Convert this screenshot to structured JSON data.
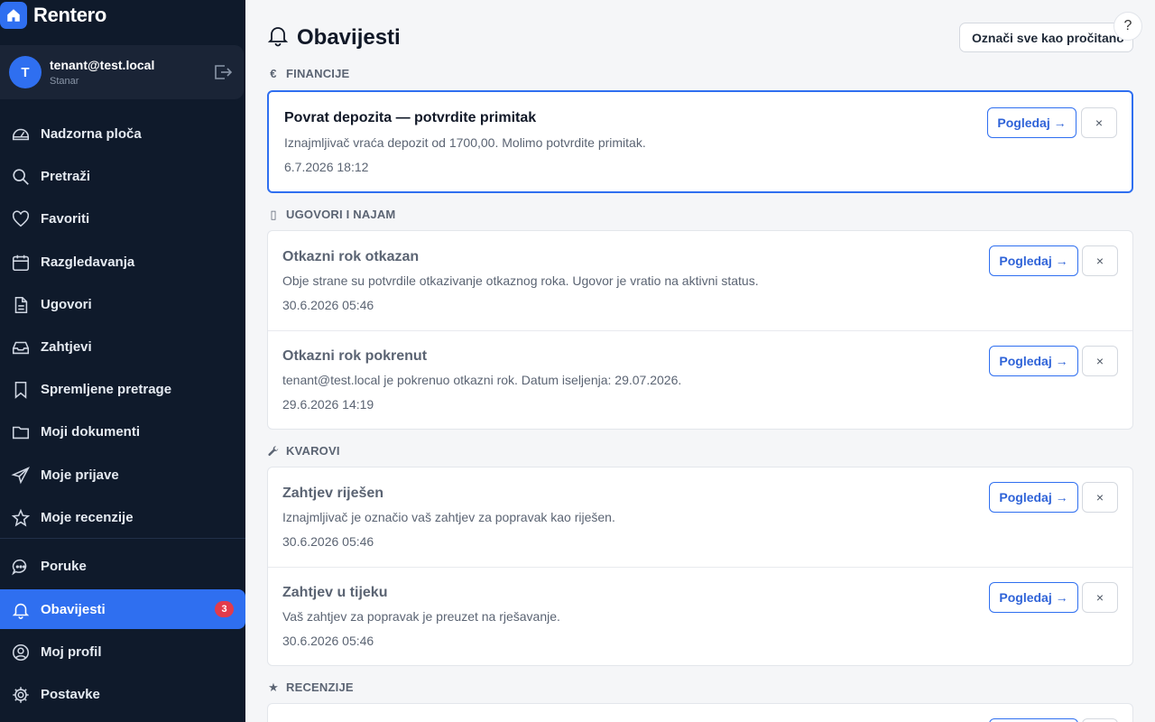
{
  "brand": {
    "name": "Rentero",
    "icon": "home-icon"
  },
  "user": {
    "initial": "T",
    "email": "tenant@test.local",
    "role": "Stanar"
  },
  "nav": [
    {
      "label": "Nadzorna ploča",
      "icon": "dashboard-icon"
    },
    {
      "label": "Pretraži",
      "icon": "search-icon"
    },
    {
      "label": "Favoriti",
      "icon": "heart-icon"
    },
    {
      "label": "Razgledavanja",
      "icon": "calendar-icon"
    },
    {
      "label": "Ugovori",
      "icon": "document-icon"
    },
    {
      "label": "Zahtjevi",
      "icon": "inbox-icon"
    },
    {
      "label": "Spremljene pretrage",
      "icon": "bookmark-icon"
    },
    {
      "label": "Moji dokumenti",
      "icon": "folder-icon"
    },
    {
      "label": "Moje prijave",
      "icon": "send-icon"
    },
    {
      "label": "Moje recenzije",
      "icon": "star-icon"
    },
    {
      "label": "Poruke",
      "icon": "chat-icon"
    },
    {
      "label": "Obavijesti",
      "icon": "bell-icon",
      "badge": "3",
      "active": true
    },
    {
      "label": "Moj profil",
      "icon": "user-circle-icon"
    },
    {
      "label": "Postavke",
      "icon": "gear-icon"
    }
  ],
  "header": {
    "title": "Obavijesti",
    "mark_all": "Označi sve kao pročitano",
    "help": "?"
  },
  "sections": [
    {
      "title": "FINANCIJE",
      "icon_glyph": "€",
      "items": [
        {
          "title": "Povrat depozita — potvrdite primitak",
          "body": "Iznajmljivač vraća depozit od 1700,00. Molimo potvrdite primitak.",
          "date": "6.7.2026 18:12",
          "unread": true
        }
      ]
    },
    {
      "title": "UGOVORI I NAJAM",
      "icon_glyph": "▯",
      "items": [
        {
          "title": "Otkazni rok otkazan",
          "body": "Obje strane su potvrdile otkazivanje otkaznog roka. Ugovor je vratio na aktivni status.",
          "date": "30.6.2026 05:46",
          "unread": false
        },
        {
          "title": "Otkazni rok pokrenut",
          "body": "tenant@test.local je pokrenuo otkazni rok. Datum iseljenja: 29.07.2026.",
          "date": "29.6.2026 14:19",
          "unread": false
        }
      ]
    },
    {
      "title": "KVAROVI",
      "icon_glyph": "🔧",
      "items": [
        {
          "title": "Zahtjev riješen",
          "body": "Iznajmljivač je označio vaš zahtjev za popravak kao riješen.",
          "date": "30.6.2026 05:46",
          "unread": false
        },
        {
          "title": "Zahtjev u tijeku",
          "body": "Vaš zahtjev za popravak je preuzet na rješavanje.",
          "date": "30.6.2026 05:46",
          "unread": false
        }
      ]
    },
    {
      "title": "RECENZIJE",
      "icon_glyph": "★",
      "items": []
    }
  ],
  "actions": {
    "view": "Pogledaj →",
    "dismiss": "×"
  },
  "colors": {
    "sidebar_bg": "#0f1a2b",
    "accent": "#2f6ff0",
    "badge": "#e23b4b"
  }
}
